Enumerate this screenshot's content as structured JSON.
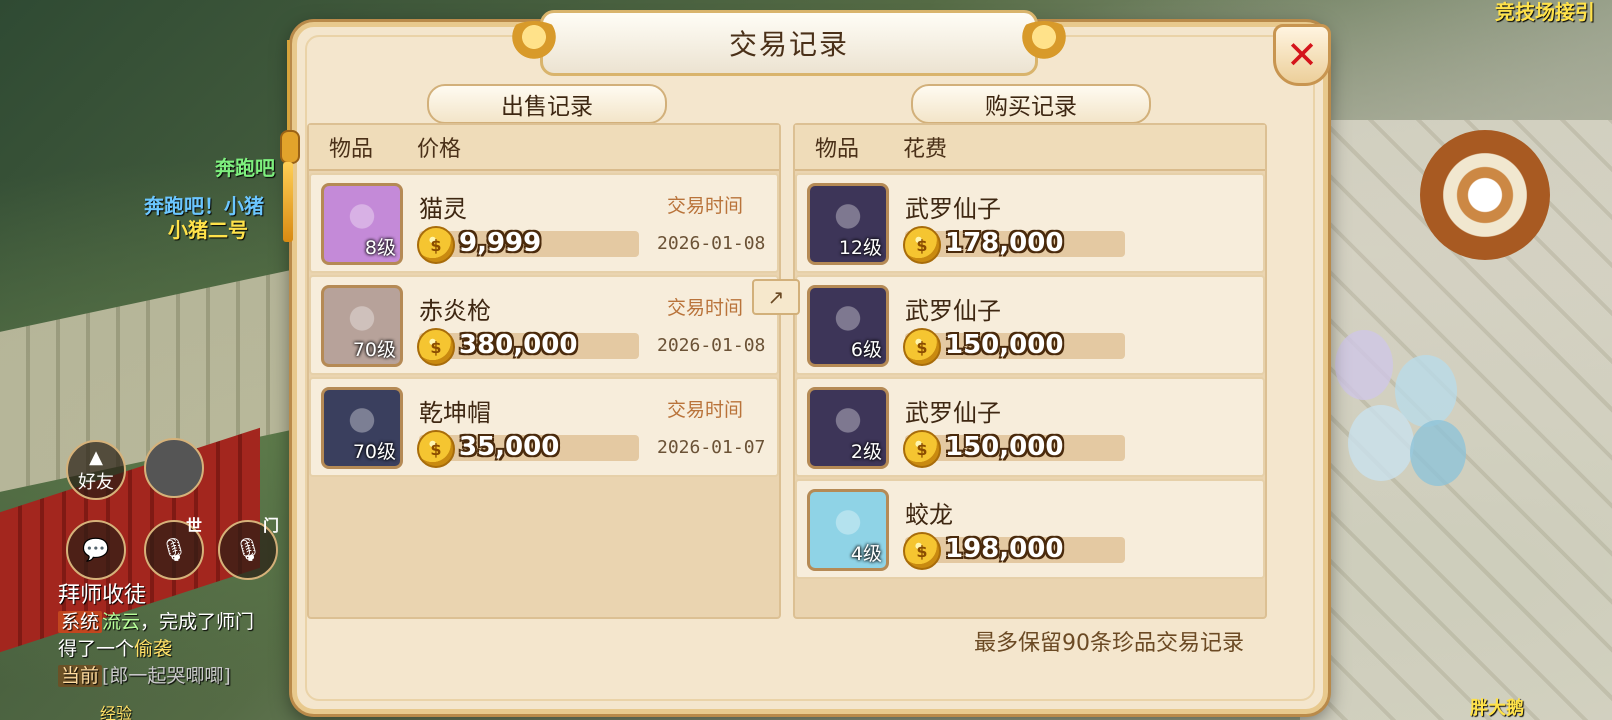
{
  "dialog": {
    "title": "交易记录",
    "close_label": "✕",
    "footnote": "最多保留90条珍品交易记录"
  },
  "sell": {
    "heading": "出售记录",
    "col_item": "物品",
    "col_price": "价格",
    "time_label": "交易时间",
    "rows": [
      {
        "name": "猫灵",
        "level": "8级",
        "price": "9,999",
        "date": "2026-01-08",
        "icon_color": "#c48ad8"
      },
      {
        "name": "赤炎枪",
        "level": "70级",
        "price": "380,000",
        "date": "2026-01-08",
        "icon_color": "#b7a29a"
      },
      {
        "name": "乾坤帽",
        "level": "70级",
        "price": "35,000",
        "date": "2026-01-07",
        "icon_color": "#3a3f5e"
      }
    ]
  },
  "buy": {
    "heading": "购买记录",
    "col_item": "物品",
    "col_cost": "花费",
    "rows": [
      {
        "name": "武罗仙子",
        "level": "12级",
        "price": "178,000",
        "icon_color": "#3d3558"
      },
      {
        "name": "武罗仙子",
        "level": "6级",
        "price": "150,000",
        "icon_color": "#3d3558"
      },
      {
        "name": "武罗仙子",
        "level": "2级",
        "price": "150,000",
        "icon_color": "#3d3558"
      },
      {
        "name": "蛟龙",
        "level": "4级",
        "price": "198,000",
        "icon_color": "#8fd3e6"
      }
    ]
  },
  "hud": {
    "friends_label": "好友",
    "channel_world": "世",
    "channel_clan": "门",
    "npc_name_1": "奔跑吧！小猪",
    "npc_name_2": "小猪二号",
    "npc_name_3": "奔跑吧",
    "right_name_1": "竞技场接引",
    "right_name_2": "胖大鹅",
    "chat_title": "拜师收徒",
    "chat_tag_system": "系统",
    "chat_line_1_name": "流云",
    "chat_line_1_text": "，完成了师门",
    "chat_line_2_a": "得了一个",
    "chat_line_2_item": "偷袭",
    "chat_tag_current": "当前",
    "chat_line_3_text": "[郎一起哭唧唧]",
    "exp_label": "经验"
  },
  "colors": {
    "dialog_bg": "#f4e6cd",
    "dialog_border": "#e8c98d",
    "close_red": "#d4141b",
    "price_outline": "#4a2a0c"
  }
}
